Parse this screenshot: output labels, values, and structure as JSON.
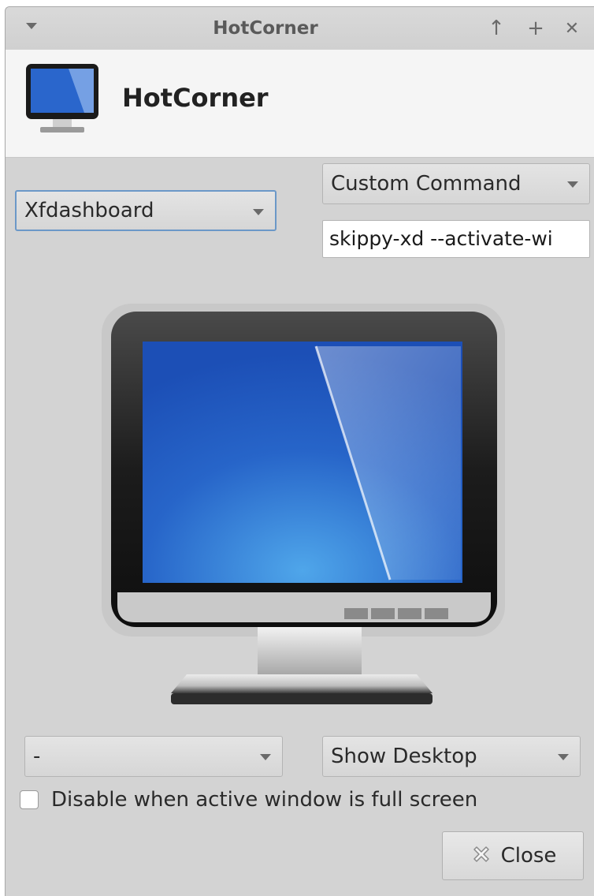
{
  "window": {
    "title": "HotCorner"
  },
  "titlebar_buttons": {
    "menu_icon": "chevron-down-icon",
    "above": "↑",
    "maximize": "+",
    "close": "✕"
  },
  "header": {
    "title": "HotCorner",
    "icon": "monitor-icon"
  },
  "corners": {
    "top_left": {
      "selected": "Xfdashboard"
    },
    "top_right": {
      "selected": "Custom Command",
      "command": "skippy-xd --activate-wi"
    },
    "bottom_left": {
      "selected": "-"
    },
    "bottom_right": {
      "selected": "Show Desktop"
    }
  },
  "options": {
    "disable_fullscreen_label": "Disable when active window is full screen",
    "disable_fullscreen_checked": false
  },
  "footer": {
    "close_label": "Close",
    "close_icon": "close-icon"
  },
  "colors": {
    "window_bg": "#d3d3d3",
    "header_bg": "#f5f5f5",
    "focus_border": "#6b98c8",
    "screen_blue": "#2a66cc"
  }
}
